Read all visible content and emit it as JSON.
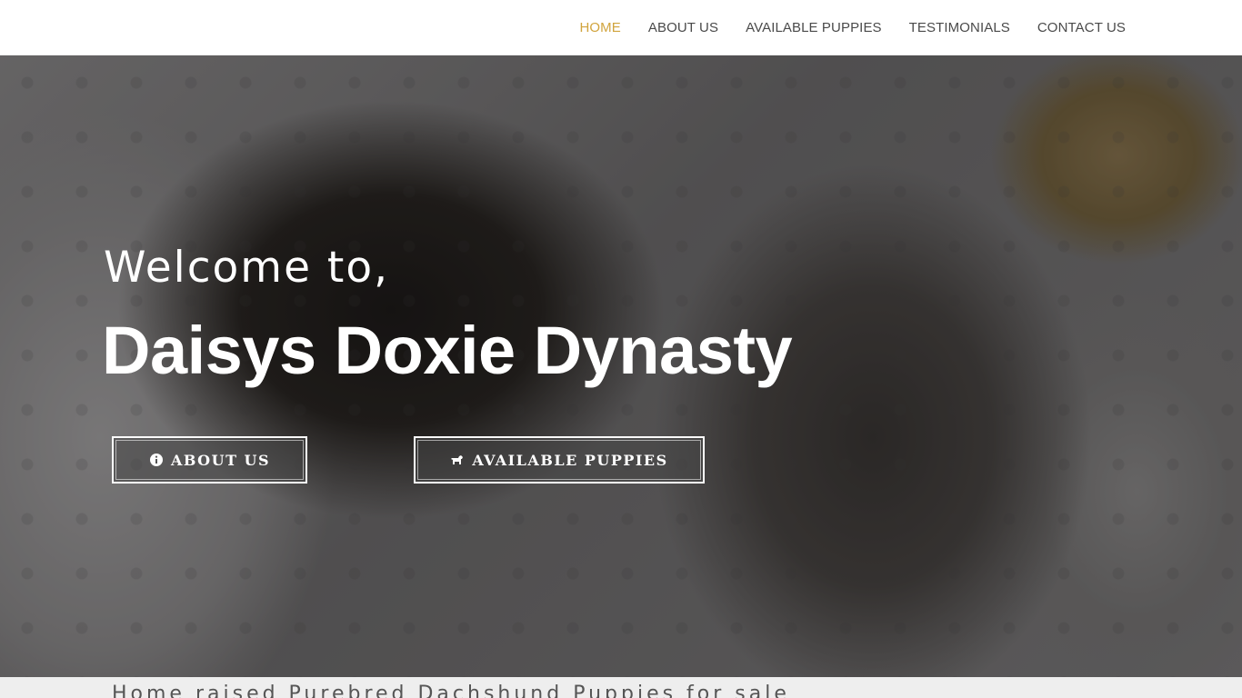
{
  "nav": {
    "items": [
      {
        "label": "HOME",
        "active": true
      },
      {
        "label": "ABOUT US",
        "active": false
      },
      {
        "label": "AVAILABLE PUPPIES",
        "active": false
      },
      {
        "label": "TESTIMONIALS",
        "active": false
      },
      {
        "label": "CONTACT US",
        "active": false
      }
    ],
    "active_color": "#d1a43d",
    "text_color": "#4a4a4a"
  },
  "hero": {
    "welcome": "Welcome to,",
    "title": "Daisys Doxie Dynasty",
    "buttons": [
      {
        "label": "ABOUT US",
        "icon": "info-circle-icon"
      },
      {
        "label": "AVAILABLE PUPPIES",
        "icon": "dog-icon"
      }
    ]
  },
  "tagline": "Home raised Purebred Dachshund Puppies for sale"
}
